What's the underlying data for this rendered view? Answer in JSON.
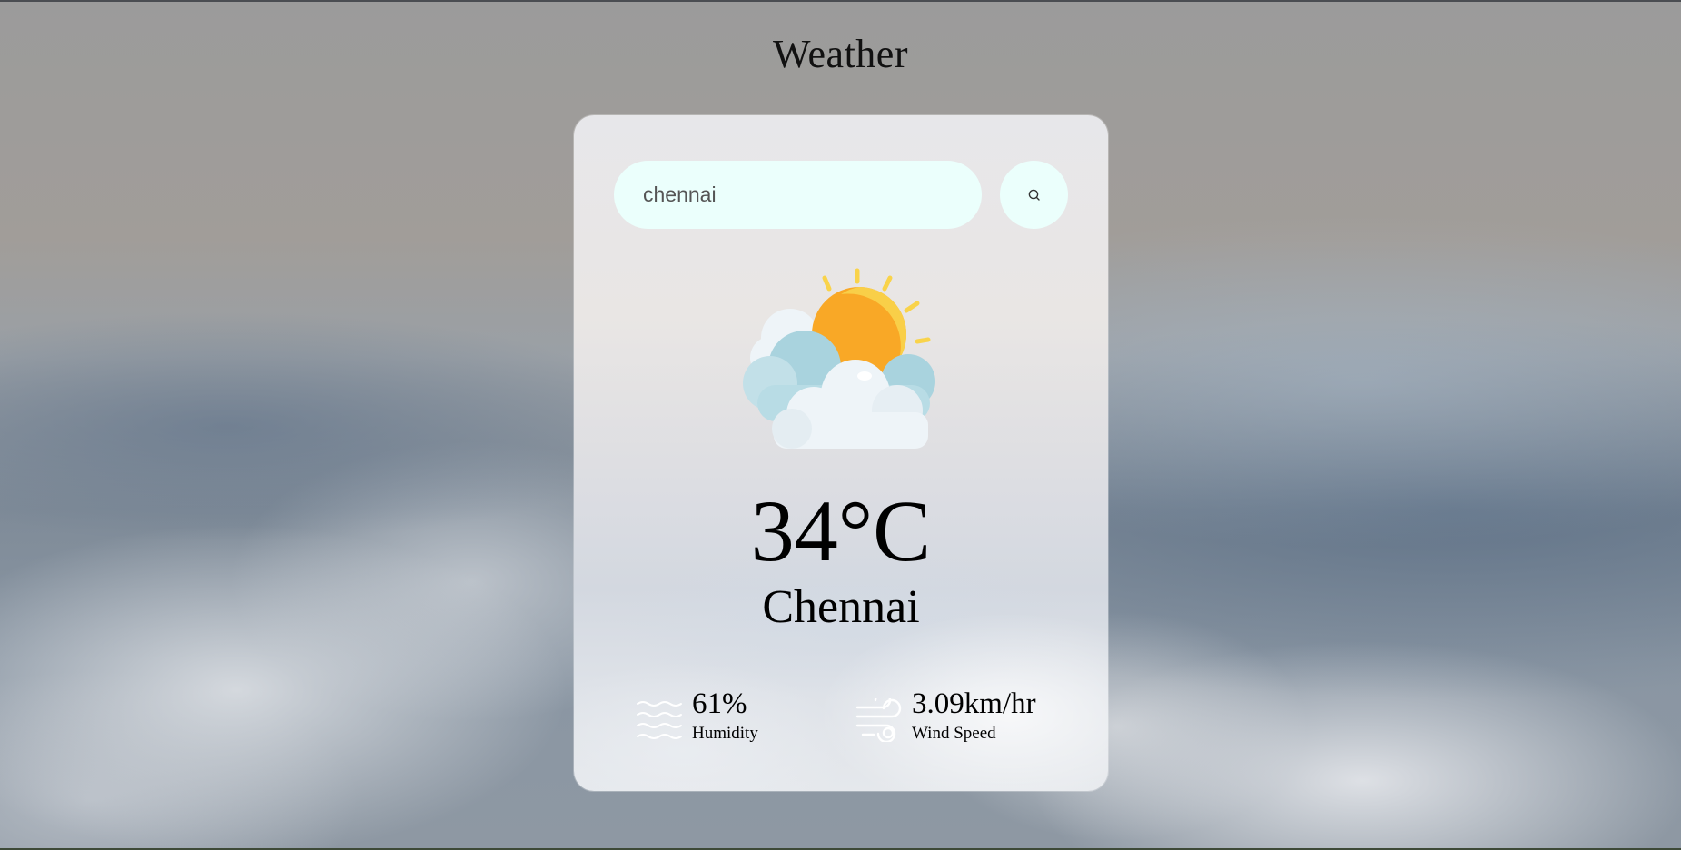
{
  "page": {
    "title": "Weather"
  },
  "search": {
    "value": "chennai",
    "button_icon": "search-icon"
  },
  "weather": {
    "icon": "sun-behind-clouds-icon",
    "temperature": "34°C",
    "city": "Chennai"
  },
  "details": {
    "humidity": {
      "icon": "humidity-waves-icon",
      "value": "61%",
      "label": "Humidity"
    },
    "wind": {
      "icon": "wind-icon",
      "value": "3.09km/hr",
      "label": "Wind Speed"
    }
  },
  "colors": {
    "input_background": "#ebfffc",
    "sun": "#f9a826",
    "sun_highlight": "#f9cf48",
    "cloud_blue": "#a9d3de",
    "cloud_white": "#eef4f8"
  }
}
